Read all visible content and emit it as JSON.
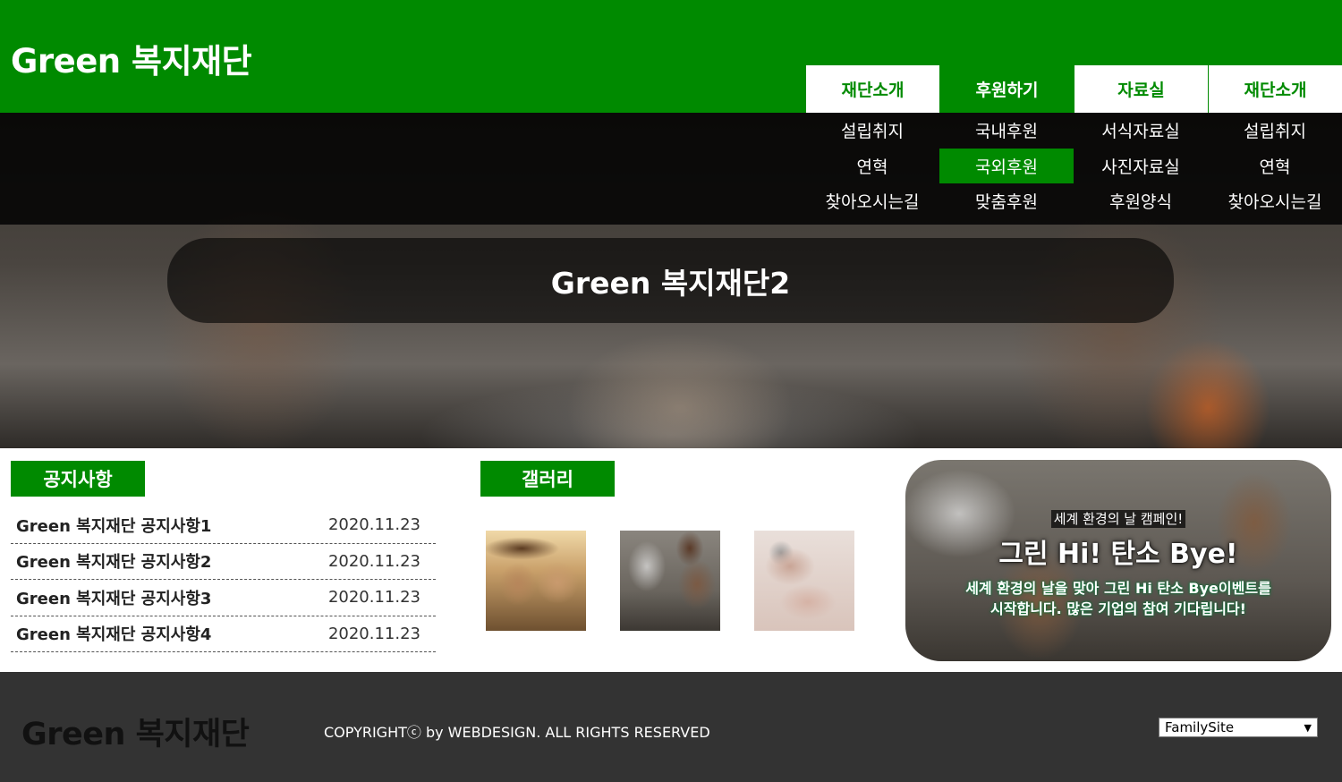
{
  "header": {
    "logo": "Green 복지재단"
  },
  "nav": [
    {
      "label": "재단소개",
      "active": false
    },
    {
      "label": "후원하기",
      "active": true
    },
    {
      "label": "자료실",
      "active": false
    },
    {
      "label": "재단소개",
      "active": false
    }
  ],
  "submenu": [
    [
      "설립취지",
      "연혁",
      "찾아오시는길"
    ],
    [
      "국내후원",
      "국외후원",
      "맞춤후원"
    ],
    [
      "서식자료실",
      "사진자료실",
      "후원양식"
    ],
    [
      "설립취지",
      "연혁",
      "찾아오시는길"
    ]
  ],
  "submenu_active": "국외후원",
  "hero": {
    "title": "Green 복지재단2"
  },
  "notice": {
    "heading": "공지사항",
    "items": [
      {
        "title": "Green 복지재단 공지사항1",
        "date": "2020.11.23"
      },
      {
        "title": "Green 복지재단 공지사항2",
        "date": "2020.11.23"
      },
      {
        "title": "Green 복지재단 공지사항3",
        "date": "2020.11.23"
      },
      {
        "title": "Green 복지재단 공지사항4",
        "date": "2020.11.23"
      }
    ]
  },
  "gallery": {
    "heading": "갤러리"
  },
  "campaign": {
    "tag": "세계 환경의 날 캠페인!",
    "title": "그린 Hi! 탄소 Bye!",
    "desc_line1": "세계 환경의 날을 맞아 그린 Hi 탄소 Bye이벤트를",
    "desc_line2": "시작합니다. 많은 기업의 참여 기다립니다!"
  },
  "footer": {
    "logo": "Green 복지재단",
    "copyright": "COPYRIGHTⓒ by WEBDESIGN. ALL RIGHTS RESERVED",
    "family_site": "FamilySite"
  },
  "colors": {
    "brand_green": "#008a00",
    "footer_bg": "#333333"
  }
}
